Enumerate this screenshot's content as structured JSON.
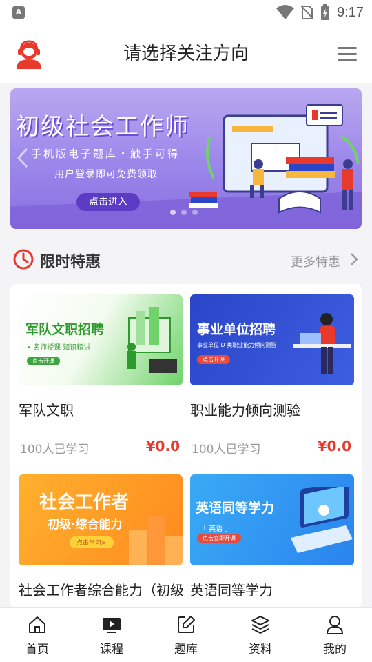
{
  "statusbar": {
    "time": "9:17",
    "app_badge": "A"
  },
  "header": {
    "title": "请选择关注方向"
  },
  "banner": {
    "title": "初级社会工作师",
    "subtitle": "手机版电子题库・触手可得",
    "note": "用户登录即可免费领取",
    "button": "点击进入"
  },
  "section": {
    "title": "限时特惠",
    "more": "更多特惠"
  },
  "courses": [
    {
      "name": "军队文职",
      "learners": "100人已学习",
      "price": "¥0.0",
      "thumb_title": "军队文职招聘",
      "thumb_sub": "• 名师授课  知识精讲",
      "thumb_btn": "点击开课"
    },
    {
      "name": "职业能力倾向测验",
      "learners": "100人已学习",
      "price": "¥0.0",
      "thumb_title": "事业单位招聘",
      "thumb_sub": "事业单位 D 类职业能力倾向测验",
      "thumb_btn": "点击开课"
    },
    {
      "name": "社会工作者综合能力（初级）",
      "learners": "",
      "price": "",
      "thumb_title": "社会工作者",
      "thumb_sub": "初级·综合能力",
      "thumb_btn": "点击学习>"
    },
    {
      "name": "英语同等学力",
      "learners": "",
      "price": "",
      "thumb_title": "英语同等学力",
      "thumb_sub": "「 英语 」",
      "thumb_btn": "点击立即开课"
    }
  ],
  "tabs": [
    {
      "label": "首页",
      "icon": "home-icon"
    },
    {
      "label": "课程",
      "icon": "video-icon"
    },
    {
      "label": "题库",
      "icon": "edit-icon"
    },
    {
      "label": "资料",
      "icon": "layers-icon"
    },
    {
      "label": "我的",
      "icon": "user-icon"
    }
  ],
  "colors": {
    "accent": "#e8392d",
    "banner": "#9b86ea"
  }
}
